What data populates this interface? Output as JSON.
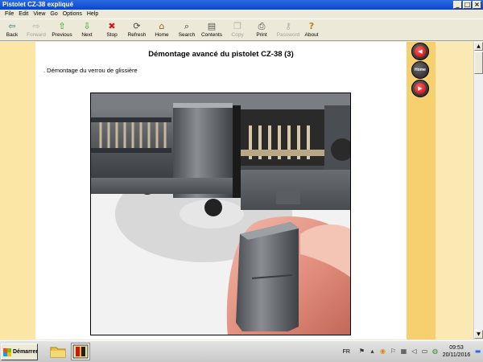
{
  "window": {
    "title": "Pistolet CZ-38 expliqué",
    "minimize": "_",
    "maximize": "□",
    "close": "×"
  },
  "menu": [
    "File",
    "Edit",
    "View",
    "Go",
    "Options",
    "Help"
  ],
  "toolbar": [
    {
      "label": "Back",
      "icon": "back-arrow-icon",
      "glyph": "⇦",
      "color": "#2a7a8a",
      "enabled": true
    },
    {
      "label": "Forward",
      "icon": "forward-arrow-icon",
      "glyph": "⇨",
      "color": "#b0b0b0",
      "enabled": false
    },
    {
      "label": "Previous",
      "icon": "previous-arrow-icon",
      "glyph": "⇧",
      "color": "#28a028",
      "enabled": true
    },
    {
      "label": "Next",
      "icon": "next-arrow-icon",
      "glyph": "⇩",
      "color": "#28a028",
      "enabled": true
    },
    {
      "label": "Stop",
      "icon": "stop-icon",
      "glyph": "✖",
      "color": "#d81818",
      "enabled": true
    },
    {
      "label": "Refresh",
      "icon": "refresh-icon",
      "glyph": "⟳",
      "color": "#444444",
      "enabled": true
    },
    {
      "label": "Home",
      "icon": "home-icon",
      "glyph": "⌂",
      "color": "#8a6a20",
      "enabled": true
    },
    {
      "label": "Search",
      "icon": "search-icon",
      "glyph": "⌕",
      "color": "#333333",
      "enabled": true
    },
    {
      "label": "Contents",
      "icon": "contents-icon",
      "glyph": "▤",
      "color": "#555555",
      "enabled": true
    },
    {
      "label": "Copy",
      "icon": "copy-icon",
      "glyph": "❐",
      "color": "#b0b0b0",
      "enabled": false
    },
    {
      "label": "Print",
      "icon": "print-icon",
      "glyph": "⎙",
      "color": "#444444",
      "enabled": true
    },
    {
      "label": "Password",
      "icon": "password-key-icon",
      "glyph": "⚷",
      "color": "#b0b0b0",
      "enabled": false
    },
    {
      "label": "About",
      "icon": "about-icon",
      "glyph": "?",
      "color": "#b08a10",
      "enabled": true
    }
  ],
  "page": {
    "title": "Démontage avancé du pistolet CZ-38 (3)",
    "subtitle": ". Démontage du verrou de glissière"
  },
  "nav": {
    "home_label": "Home"
  },
  "taskbar": {
    "start_label": "Démarrer",
    "lang": "FR",
    "time": "09:53",
    "date": "20/11/2016"
  },
  "colors": {
    "titlebar": "#0a46c8",
    "page_bg": "#ffffff",
    "band_left": "#fbe6a6",
    "band_nav": "#f6cf6e",
    "nav_red": "#c80000"
  }
}
